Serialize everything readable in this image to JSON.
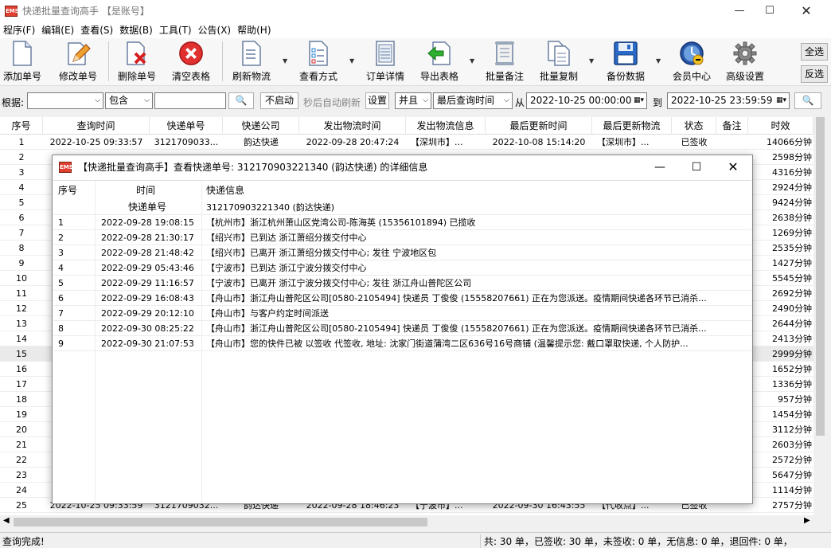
{
  "window": {
    "title": "快递批量查询高手 【是账号】"
  },
  "menu": [
    "程序(F)",
    "编辑(E)",
    "查看(S)",
    "数据(B)",
    "工具(T)",
    "公告(X)",
    "帮助(H)"
  ],
  "toolbar": {
    "buttons": [
      {
        "label": "添加单号",
        "icon": "new-document-icon"
      },
      {
        "label": "修改单号",
        "icon": "edit-pencil-icon"
      },
      {
        "label": "删除单号",
        "icon": "delete-document-icon"
      },
      {
        "label": "清空表格",
        "icon": "clear-red-x-icon"
      },
      {
        "label": "刷新物流",
        "icon": "refresh-document-icon"
      },
      {
        "label": "查看方式",
        "icon": "checklist-icon"
      },
      {
        "label": "订单详情",
        "icon": "order-details-icon"
      },
      {
        "label": "导出表格",
        "icon": "export-arrow-icon"
      },
      {
        "label": "批量备注",
        "icon": "scroll-note-icon"
      },
      {
        "label": "批量复制",
        "icon": "copy-documents-icon"
      },
      {
        "label": "备份数据",
        "icon": "floppy-disk-icon"
      },
      {
        "label": "会员中心",
        "icon": "clock-globe-icon"
      },
      {
        "label": "高级设置",
        "icon": "gear-icon"
      }
    ],
    "select_all": "全选",
    "invert_select": "反选"
  },
  "filter": {
    "basis_label": "根据:",
    "basis_value": "",
    "match_value": "包含",
    "keyword": "",
    "auto_refresh_off": "不启动",
    "auto_refresh_label": "秒后自动刷新",
    "settings": "设置",
    "logic": "并且",
    "time_field": "最后查询时间",
    "from_label": "从",
    "from_value": "2022-10-25 00:00:00",
    "to_label": "到",
    "to_value": "2022-10-25 23:59:59"
  },
  "grid": {
    "headers": [
      "序号",
      "查询时间",
      "快递单号",
      "快递公司",
      "发出物流时间",
      "发出物流信息",
      "最后更新时间",
      "最后更新物流",
      "状态",
      "备注",
      "时效"
    ],
    "rows": [
      {
        "no": "1",
        "query_time": "2022-10-25 09:33:57",
        "tracking": "3121709033...",
        "company": "韵达快递",
        "sent_time": "2022-09-28 20:47:24",
        "sent_info": "【深圳市】...",
        "last_time": "2022-10-08 15:14:20",
        "last_info": "【深圳市】...",
        "status": "已签收",
        "note": "",
        "duration": "14066分钟"
      },
      {
        "no": "2",
        "duration": "2598分钟"
      },
      {
        "no": "3",
        "duration": "4316分钟"
      },
      {
        "no": "4",
        "duration": "2924分钟"
      },
      {
        "no": "5",
        "duration": "9424分钟"
      },
      {
        "no": "6",
        "duration": "2638分钟"
      },
      {
        "no": "7",
        "duration": "1269分钟"
      },
      {
        "no": "8",
        "duration": "2535分钟"
      },
      {
        "no": "9",
        "duration": "1427分钟"
      },
      {
        "no": "10",
        "duration": "5545分钟"
      },
      {
        "no": "11",
        "duration": "2692分钟"
      },
      {
        "no": "12",
        "duration": "2490分钟"
      },
      {
        "no": "13",
        "duration": "2644分钟"
      },
      {
        "no": "14",
        "duration": "2413分钟"
      },
      {
        "no": "15",
        "duration": "2999分钟"
      },
      {
        "no": "16",
        "duration": "1652分钟"
      },
      {
        "no": "17",
        "duration": "1336分钟"
      },
      {
        "no": "18",
        "duration": "957分钟"
      },
      {
        "no": "19",
        "duration": "1454分钟"
      },
      {
        "no": "20",
        "duration": "3112分钟"
      },
      {
        "no": "21",
        "duration": "2603分钟"
      },
      {
        "no": "22",
        "duration": "2572分钟"
      },
      {
        "no": "23",
        "duration": "5647分钟"
      },
      {
        "no": "24",
        "duration": "1114分钟"
      },
      {
        "no": "25",
        "query_time": "2022-10-25 09:33:59",
        "tracking": "3121709032...",
        "company": "韵达快递",
        "sent_time": "2022-09-28 18:46:23",
        "sent_info": "【宁波市】...",
        "last_time": "2022-09-30 16:43:55",
        "last_info": "【代收点】...",
        "status": "已签收",
        "note": "",
        "duration": "2757分钟"
      }
    ],
    "selected_row": 15
  },
  "status": {
    "left": "查询完成!",
    "right": "共: 30 单，已签收: 30 单，未签收: 0 单，无信息: 0 单，退回件: 0 单，"
  },
  "dialog": {
    "title": "【快递批量查询高手】查看快递单号: 312170903221340 (韵达快递) 的详细信息",
    "headers": {
      "no": "序号",
      "time": "时间",
      "info": "快递信息"
    },
    "tracking_label": "快递单号",
    "tracking_value": "312170903221340 (韵达快递)",
    "rows": [
      {
        "no": "1",
        "time": "2022-09-28 19:08:15",
        "info": "【杭州市】浙江杭州萧山区党湾公司-陈海英 (15356101894) 已揽收"
      },
      {
        "no": "2",
        "time": "2022-09-28 21:30:17",
        "info": "【绍兴市】已到达 浙江萧绍分拨交付中心"
      },
      {
        "no": "3",
        "time": "2022-09-28 21:48:42",
        "info": "【绍兴市】已离开 浙江萧绍分拨交付中心; 发往 宁波地区包"
      },
      {
        "no": "4",
        "time": "2022-09-29 05:43:46",
        "info": "【宁波市】已到达 浙江宁波分拨交付中心"
      },
      {
        "no": "5",
        "time": "2022-09-29 11:16:57",
        "info": "【宁波市】已离开 浙江宁波分拨交付中心; 发往 浙江舟山普陀区公司"
      },
      {
        "no": "6",
        "time": "2022-09-29 16:08:43",
        "info": "【舟山市】浙江舟山普陀区公司[0580-2105494] 快递员 丁俊俊 (15558207661)  正在为您派送。疫情期间快递各环节已消杀..."
      },
      {
        "no": "7",
        "time": "2022-09-29 20:12:10",
        "info": "【舟山市】与客户约定时间派送"
      },
      {
        "no": "8",
        "time": "2022-09-30 08:25:22",
        "info": "【舟山市】浙江舟山普陀区公司[0580-2105494] 快递员 丁俊俊 (15558207661)  正在为您派送。疫情期间快递各环节已消杀..."
      },
      {
        "no": "9",
        "time": "2022-09-30 21:07:53",
        "info": "【舟山市】您的快件已被 以签收 代签收, 地址: 沈家门街道蒲湾二区636号16号商铺 (温馨提示您: 戴口罩取快递, 个人防护..."
      }
    ]
  }
}
